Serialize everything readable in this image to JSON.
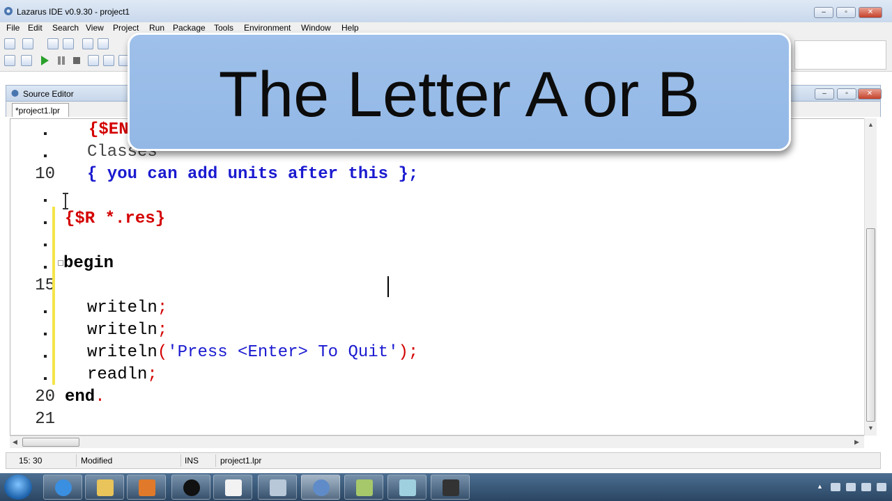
{
  "window": {
    "title": "Lazarus IDE v0.9.30 - project1"
  },
  "menu": [
    "File",
    "Edit",
    "Search",
    "View",
    "Project",
    "Run",
    "Package",
    "Tools",
    "Environment",
    "Window",
    "Help"
  ],
  "editor": {
    "title": "Source Editor",
    "tab": "*project1.lpr",
    "line_numbers": [
      "10",
      "15",
      "20",
      "21"
    ],
    "lines": {
      "l8": "{$EN",
      "l9": "Classes",
      "l10": "{ you can add units after this };",
      "l12": "{$R *.res}",
      "l14": "begin",
      "l16a": "writeln",
      "l16b": ";",
      "l17a": "writeln",
      "l17b": ";",
      "l18a": "writeln",
      "l18b": "(",
      "l18c": "'Press <Enter> To Quit'",
      "l18d": ");",
      "l19a": "readln",
      "l19b": ";",
      "l20a": "end",
      "l20b": "."
    }
  },
  "status": {
    "position": "15: 30",
    "state": "Modified",
    "mode": "INS",
    "file": "project1.lpr"
  },
  "banner": {
    "text": "The Letter A or B"
  },
  "taskbar": {
    "items": [
      "start-button",
      "internet-explorer-icon",
      "file-explorer-icon",
      "media-player-icon",
      "hp-icon",
      "pdf-icon",
      "calculator-icon",
      "lazarus-icon",
      "notes-icon",
      "paper-icon",
      "device-icon"
    ]
  },
  "colors": {
    "directive": "#d40000",
    "comment": "#1a1ad0",
    "banner": "#9ec0ea",
    "change_bar": "#f4e54a"
  }
}
